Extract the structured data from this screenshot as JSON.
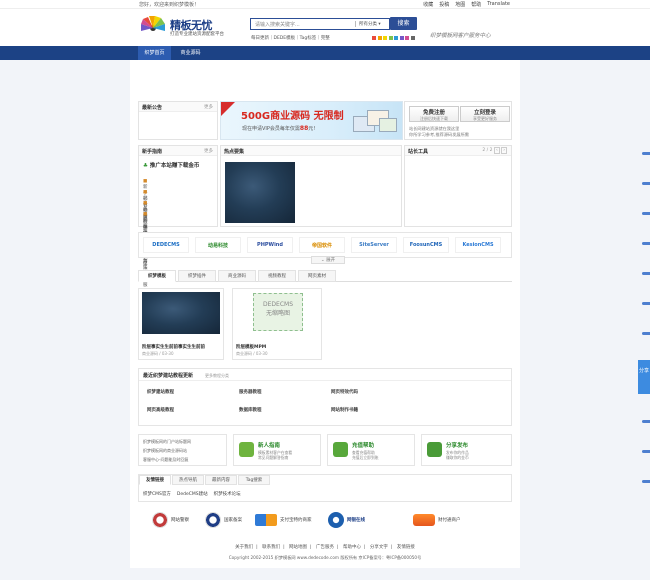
{
  "topbar": {
    "welcome": "您好，欢迎来到织梦模板！",
    "links": [
      "收藏",
      "投稿",
      "地图",
      "帮助",
      "Translate"
    ]
  },
  "header": {
    "logo_text": "精板无忧",
    "logo_sub": "打造专业建站资源配套平台",
    "search_placeholder": "请输入搜索关键字...",
    "search_category": "所有分类 ▾",
    "search_button": "搜索",
    "hot_words": "每日更新｜DEDE模板｜Tag标签｜完整",
    "slogan": "织梦模板网客户服务中心",
    "swatches": [
      "#e94b3c",
      "#f4a300",
      "#f2d600",
      "#7cc24e",
      "#2b9bd6",
      "#7357c6",
      "#d14d92",
      "#666666"
    ]
  },
  "nav": {
    "items": [
      "织梦首页",
      "商业源码"
    ]
  },
  "announce": {
    "title": "最新公告",
    "more": "更多"
  },
  "banner": {
    "headline": "500G商业源码 无限制",
    "sub_prefix": "现在申请VIP会员每年仅需",
    "price": "88",
    "sub_suffix": "元!"
  },
  "register": {
    "free_label": "免费注册",
    "free_sub": "注册后快速下载",
    "login_label": "立刻登录",
    "login_sub": "享受更好服务",
    "desc_line1": "站长网建站资源就在我这里",
    "desc_line2": "你所学习参考,推荐源码发展所需"
  },
  "guide": {
    "title": "新手指南",
    "more": "更多",
    "headline": "推广本站赚下载金币",
    "items": [
      "新手必看指南 - 详细文字版",
      "站长必备软件 - 方便又快捷",
      "各类网站模板 - 使用方法介绍",
      "客服在线支持 - 为您贴心服务"
    ]
  },
  "hot_images": {
    "title": "热点要集"
  },
  "tools": {
    "title": "站长工具",
    "pager": "2 / 2"
  },
  "brands": [
    "DEDECMS",
    "动易科技",
    "PHPWind",
    "帝国软件",
    "SiteServer",
    "FoosunCMS",
    "KesionCMS"
  ],
  "expand_label": "展开",
  "tabs": [
    "织梦模板",
    "织梦插件",
    "商业源码",
    "视频教程",
    "网页素材"
  ],
  "tiles": [
    {
      "title": "阶层事实生生前前事实生生前前",
      "meta": "商业源码 / 03-30"
    },
    {
      "title": "阶层模板MPM",
      "meta": "商业源码 / 03-30",
      "placeholder_line1": "DEDECMS",
      "placeholder_line2": "无缩略图"
    }
  ],
  "tutorials": {
    "title": "最近织梦建站教程更新",
    "sub": "更多教程分类",
    "cells": [
      "织梦建站教程",
      "服务器教程",
      "网页特效代码",
      "网页高级教程",
      "数据库教程",
      "网站制作书籍"
    ]
  },
  "bottom": {
    "list": [
      "织梦模板网的门户站标题网",
      "织梦模板网的商业源码站",
      "客服中心-问题能及时回复"
    ],
    "boxes": [
      {
        "title": "新人指南",
        "desc1": "模板素材客户在查看",
        "desc2": "常见问题解答指南"
      },
      {
        "title": "充值帮助",
        "desc1": "查看充值帮助",
        "desc2": "充值后立即到账"
      },
      {
        "title": "分享发布",
        "desc1": "发布你的作品",
        "desc2": "赚取你的金币"
      }
    ]
  },
  "friend_links": {
    "tabs": [
      "友情链接",
      "热点导航",
      "最新内容",
      "Tag搜索"
    ],
    "items": [
      "织梦CMS官方",
      "DedeCMS建站",
      "织梦技术论坛"
    ]
  },
  "certs": [
    "网站警察",
    "国家备案",
    "支付宝特约商家",
    "网银在线",
    "财付通商户"
  ],
  "footer": {
    "links": [
      "关于我们",
      "联系我们",
      "网站地图",
      "广告服务",
      "帮助中心",
      "分享文字",
      "友情链接"
    ],
    "copyright": "Copyright 2002-2015 织梦模板网 www.dedecode.com 版权所有 京ICP备案号：粤ICP备000050号"
  },
  "share_label": "分享"
}
